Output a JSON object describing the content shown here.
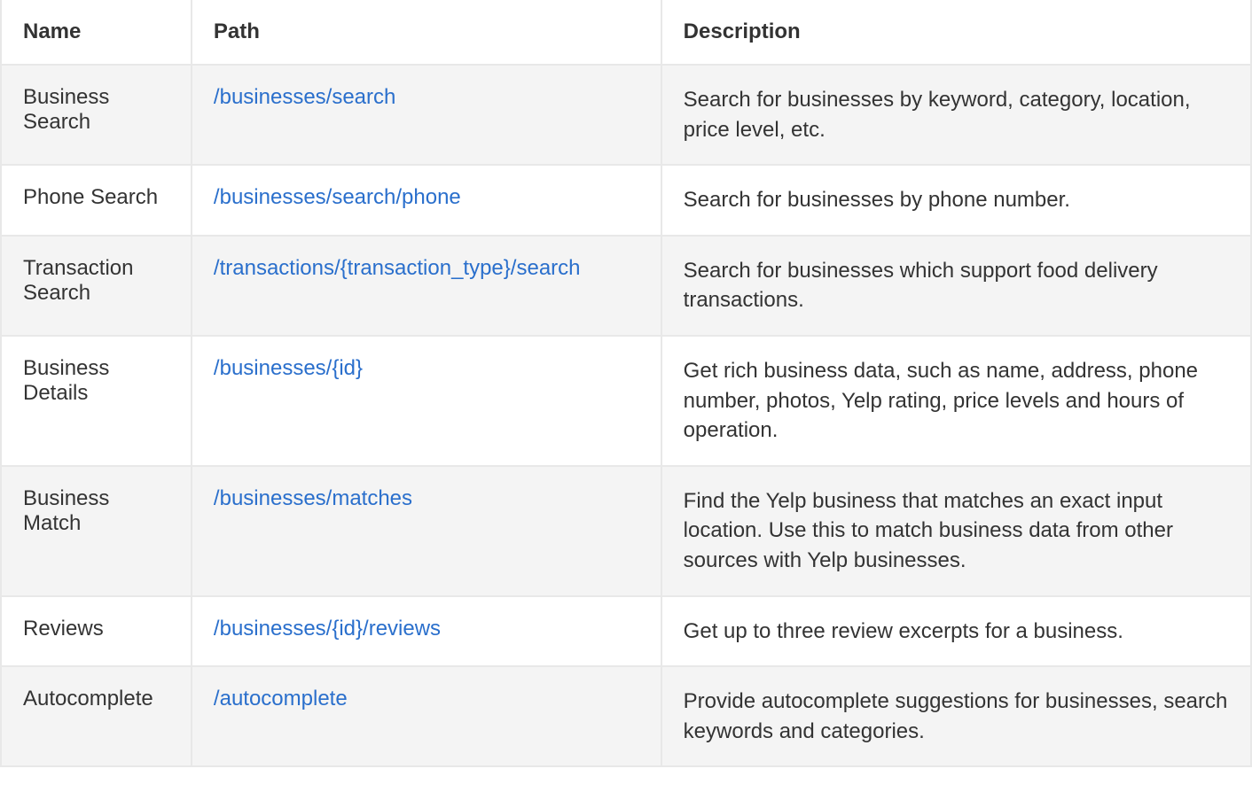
{
  "table": {
    "headers": {
      "name": "Name",
      "path": "Path",
      "description": "Description"
    },
    "rows": [
      {
        "name": "Business Search",
        "path": "/businesses/search",
        "description": "Search for businesses by keyword, category, location, price level, etc."
      },
      {
        "name": "Phone Search",
        "path": "/businesses/search/phone",
        "description": "Search for businesses by phone number."
      },
      {
        "name": "Transaction Search",
        "path": "/transactions/{transaction_type}/search",
        "description": "Search for businesses which support food delivery transactions."
      },
      {
        "name": "Business Details",
        "path": "/businesses/{id}",
        "description": "Get rich business data, such as name, address, phone number, photos, Yelp rating, price levels and hours of operation."
      },
      {
        "name": "Business Match",
        "path": "/businesses/matches",
        "description": "Find the Yelp business that matches an exact input location. Use this to match business data from other sources with Yelp businesses."
      },
      {
        "name": "Reviews",
        "path": "/businesses/{id}/reviews",
        "description": "Get up to three review excerpts for a business."
      },
      {
        "name": "Autocomplete",
        "path": "/autocomplete",
        "description": "Provide autocomplete suggestions for businesses, search keywords and categories."
      }
    ]
  }
}
